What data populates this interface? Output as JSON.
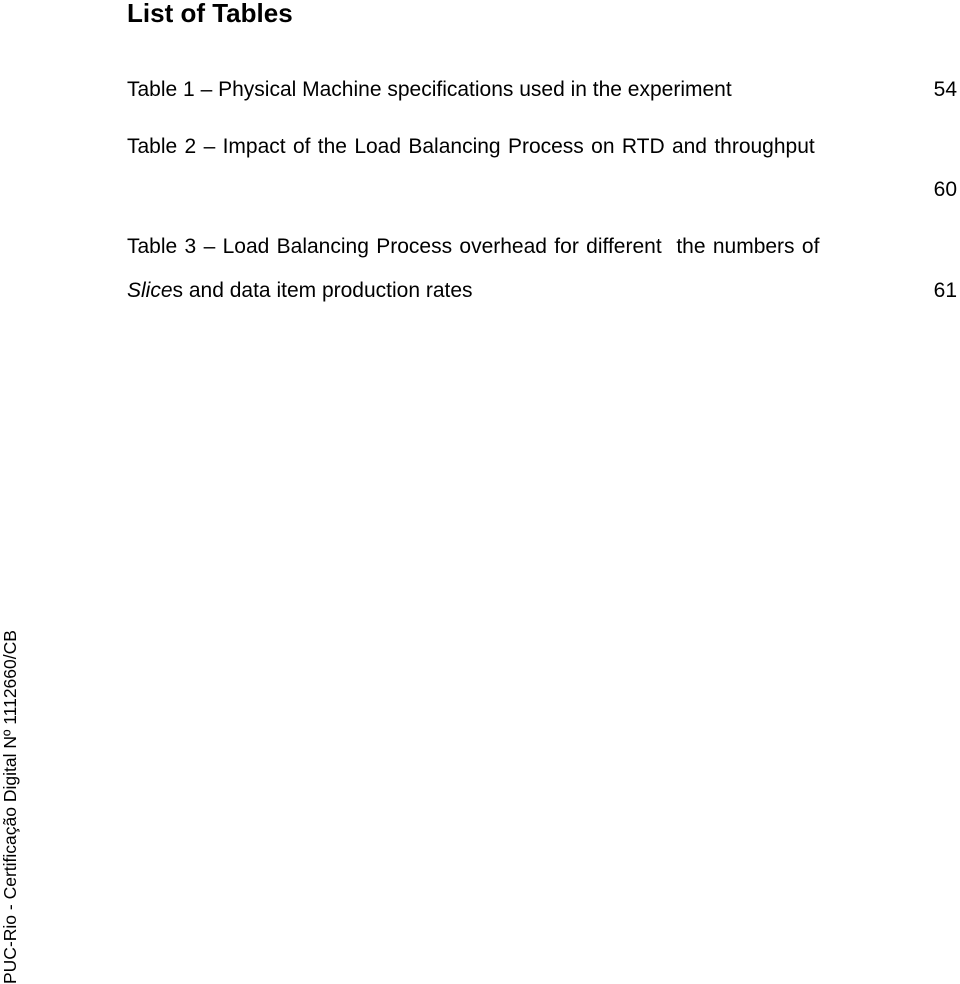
{
  "heading": "List of Tables",
  "entries": [
    {
      "label": "Table 1",
      "dash": "–",
      "text": "Physical Machine specifications used in the experiment",
      "page": "54"
    },
    {
      "label": "Table 2",
      "dash": "–",
      "text": "Impact of the Load Balancing Process on RTD and throughput",
      "page": "60"
    },
    {
      "label": "Table 3",
      "dash": "–",
      "text_line1": "Load Balancing Process overhead for different  the numbers of",
      "text_line2_italic": "Slice",
      "text_line2_rest": "s and data item production rates",
      "page": "61"
    }
  ],
  "side_watermark": "PUC-Rio - Certificação Digital Nº 1112660/CB"
}
